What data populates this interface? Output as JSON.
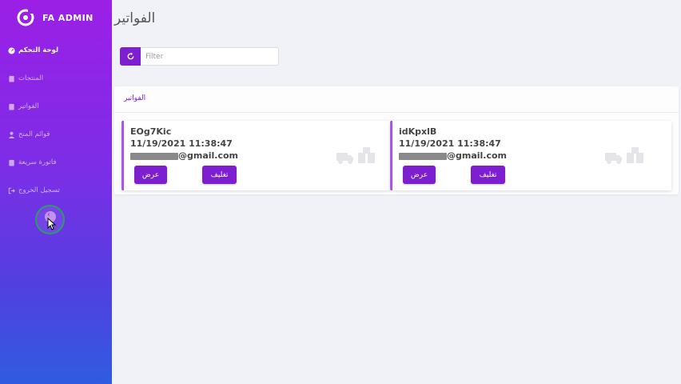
{
  "brand": {
    "name": "FA ADMIN"
  },
  "sidebar": {
    "items": [
      {
        "label": "لوحة التحكم",
        "icon": "dashboard-icon",
        "active": true
      },
      {
        "label": "المنتجات",
        "icon": "clipboard-icon",
        "active": false
      },
      {
        "label": "الفواتير",
        "icon": "clipboard-icon",
        "active": false
      },
      {
        "label": "قوائم المنح",
        "icon": "user-icon",
        "active": false
      },
      {
        "label": "فاتورة سريعة",
        "icon": "clipboard-icon",
        "active": false
      },
      {
        "label": "تسجيل الخروج",
        "icon": "logout-icon",
        "active": false
      }
    ]
  },
  "page": {
    "title": "الفواتير"
  },
  "filter": {
    "placeholder": "Filter"
  },
  "panel": {
    "title": "الفواتير"
  },
  "invoices": [
    {
      "code": "EOg7Kic",
      "datetime": "11/19/2021 11:38:47",
      "email_suffix": "@gmail.com",
      "view_label": "عرض",
      "close_label": "تغليف"
    },
    {
      "code": "idKpxlB",
      "datetime": "11/19/2021 11:38:47",
      "email_suffix": "@gmail.com",
      "view_label": "عرض",
      "close_label": "تغليف"
    }
  ],
  "colors": {
    "accent": "#7d1fd0",
    "sidebar_top": "#9c1fe6",
    "sidebar_bottom": "#2f5ce0"
  }
}
